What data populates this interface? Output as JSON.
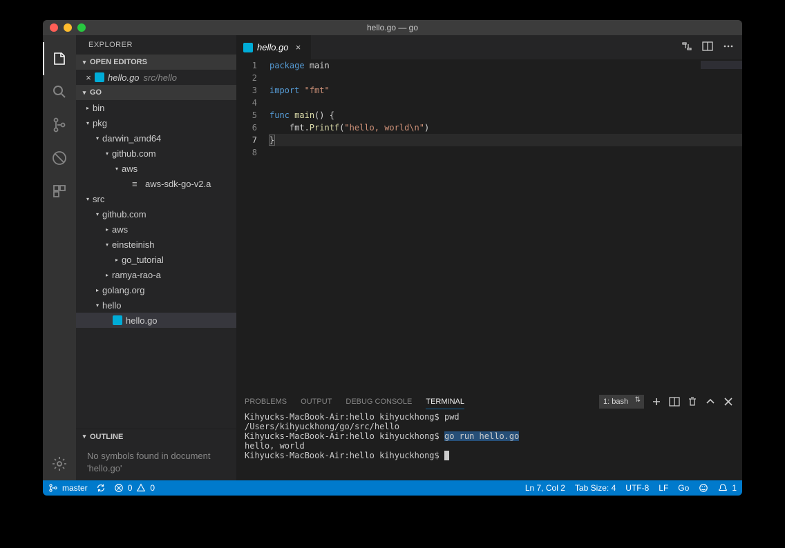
{
  "window_title": "hello.go — go",
  "sidebar": {
    "title": "EXPLORER",
    "open_editors_label": "OPEN EDITORS",
    "open_editor_file": "hello.go",
    "open_editor_path": "src/hello",
    "workspace_label": "GO",
    "outline_label": "OUTLINE",
    "outline_msg": "No symbols found in document 'hello.go'"
  },
  "tree": [
    {
      "d": 0,
      "t": "bin",
      "exp": false,
      "kind": "folder"
    },
    {
      "d": 0,
      "t": "pkg",
      "exp": true,
      "kind": "folder"
    },
    {
      "d": 1,
      "t": "darwin_amd64",
      "exp": true,
      "kind": "folder"
    },
    {
      "d": 2,
      "t": "github.com",
      "exp": true,
      "kind": "folder"
    },
    {
      "d": 3,
      "t": "aws",
      "exp": true,
      "kind": "folder"
    },
    {
      "d": 4,
      "t": "aws-sdk-go-v2.a",
      "exp": false,
      "kind": "file-a"
    },
    {
      "d": 0,
      "t": "src",
      "exp": true,
      "kind": "folder"
    },
    {
      "d": 1,
      "t": "github.com",
      "exp": true,
      "kind": "folder"
    },
    {
      "d": 2,
      "t": "aws",
      "exp": false,
      "kind": "folder"
    },
    {
      "d": 2,
      "t": "einsteinish",
      "exp": true,
      "kind": "folder"
    },
    {
      "d": 3,
      "t": "go_tutorial",
      "exp": false,
      "kind": "folder"
    },
    {
      "d": 2,
      "t": "ramya-rao-a",
      "exp": false,
      "kind": "folder"
    },
    {
      "d": 1,
      "t": "golang.org",
      "exp": false,
      "kind": "folder"
    },
    {
      "d": 1,
      "t": "hello",
      "exp": true,
      "kind": "folder"
    },
    {
      "d": 2,
      "t": "hello.go",
      "exp": false,
      "kind": "file-go",
      "sel": true
    }
  ],
  "tab": {
    "label": "hello.go"
  },
  "code_lines": [
    {
      "n": 1,
      "html": "<span class='kw'>package</span> <span class='id'>main</span>"
    },
    {
      "n": 2,
      "html": ""
    },
    {
      "n": 3,
      "html": "<span class='kw'>import</span> <span class='str'>\"fmt\"</span>"
    },
    {
      "n": 4,
      "html": ""
    },
    {
      "n": 5,
      "html": "<span class='kw'>func</span> <span class='fn'>main</span><span class='pn'>()</span> <span class='pn'>{</span>"
    },
    {
      "n": 6,
      "html": "    fmt.<span class='fn'>Printf</span>(<span class='str'>\"hello, world\\n\"</span>)"
    },
    {
      "n": 7,
      "html": "<span class='pn cursorbox'>}</span>",
      "current": true
    },
    {
      "n": 8,
      "html": ""
    }
  ],
  "panel": {
    "tabs": [
      "PROBLEMS",
      "OUTPUT",
      "DEBUG CONSOLE",
      "TERMINAL"
    ],
    "active_tab": 3,
    "terminal_select": "1: bash",
    "lines": [
      {
        "prompt": "Kihyucks-MacBook-Air:hello kihyuckhong$ ",
        "cmd": "pwd"
      },
      {
        "out": "/Users/kihyuckhong/go/src/hello"
      },
      {
        "prompt": "Kihyucks-MacBook-Air:hello kihyuckhong$ ",
        "cmd": "go run hello.go",
        "hl": true
      },
      {
        "out": "hello, world"
      },
      {
        "prompt": "Kihyucks-MacBook-Air:hello kihyuckhong$ ",
        "cursor": true
      }
    ]
  },
  "status": {
    "branch": "master",
    "errors": "0",
    "warnings": "0",
    "ln_col": "Ln 7, Col 2",
    "tab_size": "Tab Size: 4",
    "encoding": "UTF-8",
    "eol": "LF",
    "lang": "Go",
    "notif": "1"
  }
}
